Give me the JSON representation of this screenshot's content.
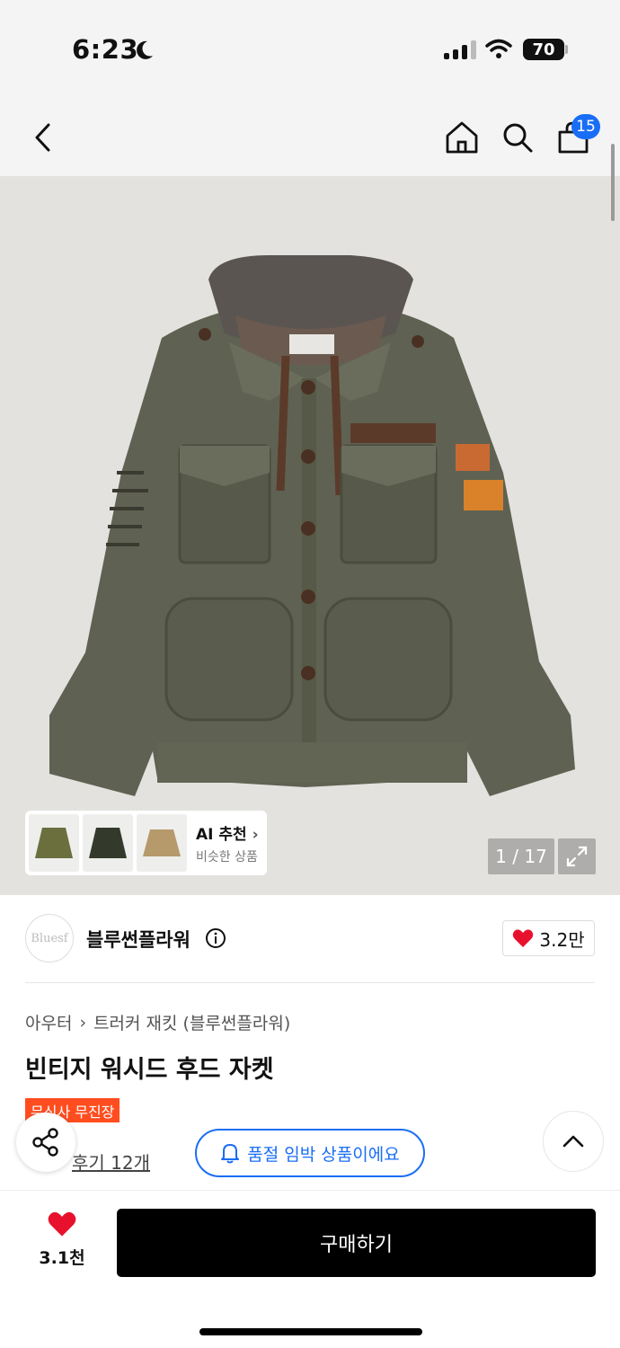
{
  "status_bar": {
    "time": "6:23",
    "battery": "70"
  },
  "nav": {
    "cart_count": "15"
  },
  "gallery": {
    "ai_title": "AI 추천",
    "ai_subtitle": "비슷한 상품",
    "counter": "1 / 17"
  },
  "brand": {
    "logo_text": "Bluesf",
    "name": "블루썬플라워",
    "likes": "3.2만"
  },
  "product": {
    "category": "아우터",
    "subcategory": "트러커 재킷 (블루썬플라워)",
    "title": "빈티지 워시드 후드 자켓",
    "tag": "무신사 무진장",
    "reviews": "후기 12개",
    "stock_notice": "품절 임박 상품이에요"
  },
  "bottom": {
    "wish_count": "3.1천",
    "buy_label": "구매하기"
  },
  "colors": {
    "accent_blue": "#1a6ef5",
    "tag_orange": "#ff4d1f",
    "heart_red": "#e8112d",
    "buy_black": "#000000"
  },
  "icons": [
    "moon-icon",
    "signal-icon",
    "wifi-icon",
    "back-icon",
    "home-icon",
    "search-icon",
    "cart-icon",
    "expand-icon",
    "info-icon",
    "heart-icon",
    "share-icon",
    "bell-icon",
    "chevron-up-icon"
  ]
}
